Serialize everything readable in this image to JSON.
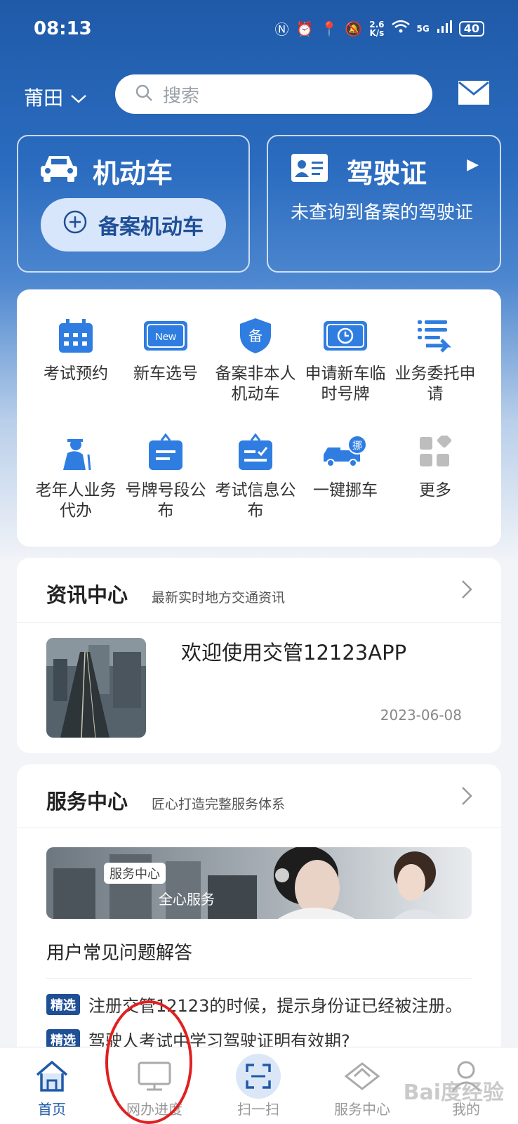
{
  "status_bar": {
    "time": "08:13",
    "speed_top": "2.6",
    "speed_bottom": "K/s",
    "network": "5G",
    "battery": "40"
  },
  "header": {
    "city": "莆田",
    "search_placeholder": "搜索"
  },
  "car_card": {
    "title": "机动车",
    "register_button": "备案机动车"
  },
  "license_card": {
    "title": "驾驶证",
    "description": "未查询到备案的驾驶证"
  },
  "services": [
    {
      "label": "考试预约"
    },
    {
      "label": "新车选号"
    },
    {
      "label": "备案非本人机动车"
    },
    {
      "label": "申请新车临时号牌"
    },
    {
      "label": "业务委托申请"
    },
    {
      "label": "老年人业务代办"
    },
    {
      "label": "号牌号段公布"
    },
    {
      "label": "考试信息公布"
    },
    {
      "label": "一键挪车"
    },
    {
      "label": "更多"
    }
  ],
  "icon_text": {
    "new": "New",
    "bei": "备",
    "nuo": "挪"
  },
  "news": {
    "title": "资讯中心",
    "subtitle": "最新实时地方交通资讯",
    "item_title": "欢迎使用交管12123APP",
    "item_date": "2023-06-08"
  },
  "service_center": {
    "title": "服务中心",
    "subtitle": "匠心打造完整服务体系",
    "banner_tag": "服务中心",
    "banner_text": "全心服务",
    "faq_title": "用户常见问题解答",
    "faqs": [
      {
        "badge": "精选",
        "text": "注册交管12123的时候，提示身份证已经被注册。"
      },
      {
        "badge": "精选",
        "text": "驾驶人考试中学习驾驶证明有效期?"
      }
    ]
  },
  "bottom_nav": [
    {
      "label": "首页",
      "active": true
    },
    {
      "label": "网办进度",
      "active": false
    },
    {
      "label": "扫一扫",
      "active": false
    },
    {
      "label": "服务中心",
      "active": false
    },
    {
      "label": "我的",
      "active": false
    }
  ],
  "watermark": "Bai度经验",
  "colors": {
    "primary": "#1f5aa8",
    "accent_light": "#d8e6fb",
    "icon_blue": "#2f7de1",
    "annotation_red": "#e02020"
  }
}
